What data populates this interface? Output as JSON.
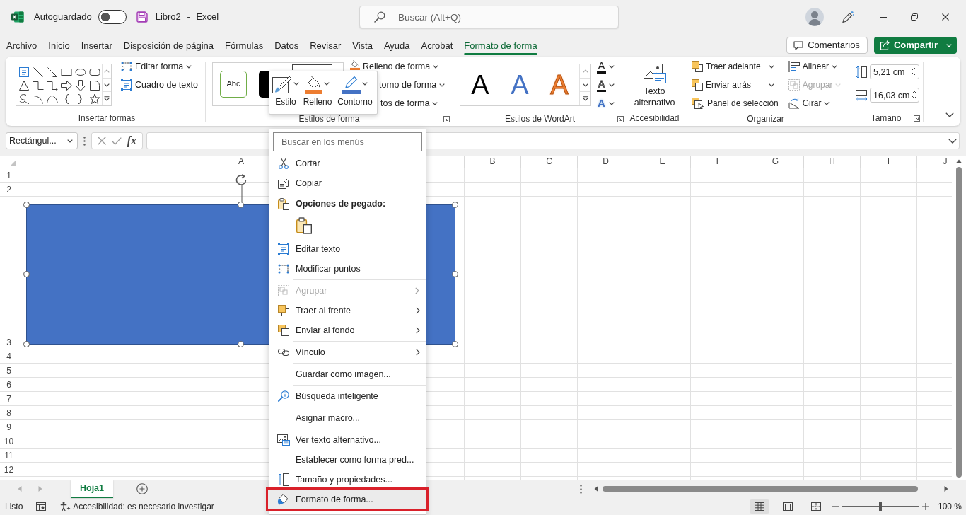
{
  "title_bar": {
    "autosave": {
      "label": "Autoguardado",
      "on": false
    },
    "document_title": "Libro2 - Excel",
    "search": {
      "placeholder": "Buscar (Alt+Q)"
    }
  },
  "ribbon_tabs": [
    {
      "label": "Archivo",
      "selected": false
    },
    {
      "label": "Inicio",
      "selected": false
    },
    {
      "label": "Insertar",
      "selected": false
    },
    {
      "label": "Disposición de página",
      "selected": false
    },
    {
      "label": "Fórmulas",
      "selected": false
    },
    {
      "label": "Datos",
      "selected": false
    },
    {
      "label": "Revisar",
      "selected": false
    },
    {
      "label": "Vista",
      "selected": false
    },
    {
      "label": "Ayuda",
      "selected": false
    },
    {
      "label": "Acrobat",
      "selected": false
    },
    {
      "label": "Formato de forma",
      "selected": true
    }
  ],
  "tab_actions": {
    "comments": "Comentarios",
    "share": "Compartir"
  },
  "ribbon": {
    "insert_shapes": {
      "label": "Insertar formas",
      "buttons": [
        {
          "label": "Editar forma",
          "dropdown": true
        },
        {
          "label": "Cuadro de texto",
          "dropdown": false
        }
      ]
    },
    "shape_styles": {
      "label": "Estilos de forma",
      "preview": "Abc",
      "buttons": [
        {
          "label": "Relleno de forma",
          "dropdown": true
        },
        {
          "label": "torno de forma",
          "dropdown": true
        },
        {
          "label": "tos de forma",
          "dropdown": true
        }
      ]
    },
    "wordart_styles": {
      "label": "Estilos de WordArt",
      "previews": [
        {
          "text": "A",
          "color": "#000000",
          "outline": false
        },
        {
          "text": "A",
          "color": "#4472c4",
          "outline": false
        },
        {
          "text": "A",
          "color": "#ed7d31",
          "outline": true
        }
      ],
      "text_tools": [
        {
          "kind": "fill",
          "glyph": "A",
          "dropdown": true
        },
        {
          "kind": "outline",
          "glyph": "A",
          "dropdown": true
        },
        {
          "kind": "effects",
          "glyph": "A",
          "dropdown": true
        }
      ]
    },
    "accessibility": {
      "label": "Accesibilidad",
      "button": "Texto alternativo"
    },
    "arrange": {
      "label": "Organizar",
      "buttons": [
        {
          "label": "Traer adelante",
          "dropdown": true,
          "disabled": false
        },
        {
          "label": "Enviar atrás",
          "dropdown": true,
          "disabled": false
        },
        {
          "label": "Panel de selección",
          "dropdown": false,
          "disabled": false
        },
        {
          "label": "Alinear",
          "dropdown": true,
          "disabled": false
        },
        {
          "label": "Agrupar",
          "dropdown": true,
          "disabled": true
        },
        {
          "label": "Girar",
          "dropdown": true,
          "disabled": false
        }
      ]
    },
    "size": {
      "label": "Tamaño",
      "height": "5,21 cm",
      "width": "16,03 cm"
    }
  },
  "mini_toolbar": [
    {
      "label": "Estilo",
      "dropdown": true
    },
    {
      "label": "Relleno",
      "dropdown": true
    },
    {
      "label": "Contorno",
      "dropdown": true
    }
  ],
  "formula_bar": {
    "name_box": "Rectángul...",
    "function_button": "fx"
  },
  "sheet": {
    "columns": [
      "A",
      "B",
      "C",
      "D",
      "E",
      "F",
      "G",
      "H",
      "I",
      "J"
    ],
    "rows": [
      "1",
      "2",
      "3",
      "4",
      "5",
      "6",
      "7",
      "8",
      "9",
      "10",
      "11",
      "12"
    ],
    "shape": {
      "selected": true
    }
  },
  "sheet_tabs": [
    {
      "label": "Hoja1",
      "selected": true
    }
  ],
  "status_bar": {
    "status": "Listo",
    "accessibility": "Accesibilidad: es necesario investigar",
    "views": [
      {
        "selected": true
      },
      {
        "selected": false
      },
      {
        "selected": false
      }
    ],
    "zoom": {
      "level": 0.5,
      "reading": "100 %"
    }
  },
  "context_menu": {
    "search": {
      "placeholder": "Buscar en los menús"
    },
    "items": [
      {
        "kind": "command",
        "label": "Cortar",
        "disabled": false,
        "submenu": false,
        "split": false,
        "highlighted": false
      },
      {
        "kind": "command",
        "label": "Copiar",
        "disabled": false,
        "submenu": false,
        "split": false,
        "highlighted": false
      },
      {
        "kind": "header",
        "label": "Opciones de pegado:"
      },
      {
        "kind": "paste_options"
      },
      {
        "kind": "separator"
      },
      {
        "kind": "command",
        "label": "Editar texto",
        "disabled": false,
        "submenu": false,
        "split": false,
        "highlighted": false
      },
      {
        "kind": "command",
        "label": "Modificar puntos",
        "disabled": false,
        "submenu": false,
        "split": false,
        "highlighted": false
      },
      {
        "kind": "separator"
      },
      {
        "kind": "command",
        "label": "Agrupar",
        "disabled": true,
        "submenu": true,
        "split": false,
        "highlighted": false
      },
      {
        "kind": "command",
        "label": "Traer al frente",
        "disabled": false,
        "submenu": true,
        "split": true,
        "highlighted": false
      },
      {
        "kind": "command",
        "label": "Enviar al fondo",
        "disabled": false,
        "submenu": true,
        "split": true,
        "highlighted": false
      },
      {
        "kind": "separator"
      },
      {
        "kind": "command",
        "label": "Vínculo",
        "disabled": false,
        "submenu": true,
        "split": true,
        "highlighted": false
      },
      {
        "kind": "separator"
      },
      {
        "kind": "command",
        "label": "Guardar como imagen...",
        "disabled": false,
        "submenu": false,
        "split": false,
        "highlighted": false
      },
      {
        "kind": "separator"
      },
      {
        "kind": "command",
        "label": "Búsqueda inteligente",
        "disabled": false,
        "submenu": false,
        "split": false,
        "highlighted": false
      },
      {
        "kind": "separator"
      },
      {
        "kind": "command",
        "label": "Asignar macro...",
        "disabled": false,
        "submenu": false,
        "split": false,
        "highlighted": false
      },
      {
        "kind": "separator"
      },
      {
        "kind": "command",
        "label": "Ver texto alternativo...",
        "disabled": false,
        "submenu": false,
        "split": false,
        "highlighted": false
      },
      {
        "kind": "command",
        "label": "Establecer como forma pred...",
        "disabled": false,
        "submenu": false,
        "split": false,
        "highlighted": false
      },
      {
        "kind": "command",
        "label": "Tamaño y propiedades...",
        "disabled": false,
        "submenu": false,
        "split": false,
        "highlighted": false
      },
      {
        "kind": "command",
        "label": "Formato de forma...",
        "disabled": false,
        "submenu": false,
        "split": false,
        "highlighted": true
      }
    ]
  }
}
